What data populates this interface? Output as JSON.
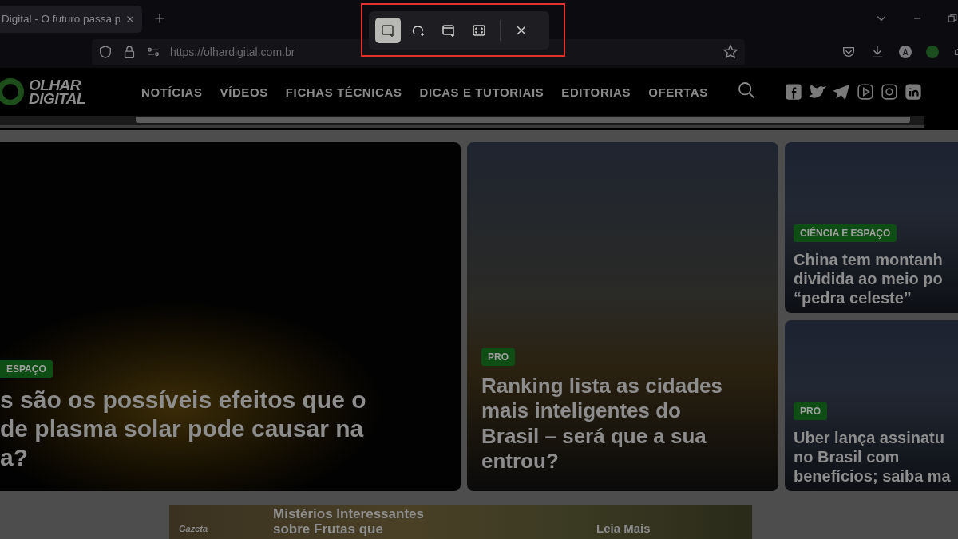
{
  "browser": {
    "tab_title": "Digital - O futuro passa p",
    "url": "https://olhardigital.com.br",
    "account_initial": "A"
  },
  "snip_toolbar": {
    "modes": [
      {
        "kind": "rectangle",
        "selected": true
      },
      {
        "kind": "freeform",
        "selected": false
      },
      {
        "kind": "window",
        "selected": false
      },
      {
        "kind": "fullscreen",
        "selected": false
      }
    ]
  },
  "site": {
    "logo_lines": [
      "OLHAR",
      "DIGITAL"
    ],
    "nav": [
      "NOTÍCIAS",
      "VÍDEOS",
      "FICHAS TÉCNICAS",
      "DICAS E TUTORIAIS",
      "EDITORIAS",
      "OFERTAS"
    ]
  },
  "cards": [
    {
      "kind": "large",
      "tag": "ESPAÇO",
      "headline_lines": [
        "s são os possíveis efeitos que o",
        "de plasma solar pode causar na",
        "a?"
      ]
    },
    {
      "kind": "medium",
      "tag": "PRO",
      "headline_lines": [
        "Ranking lista as cidades",
        "mais inteligentes do",
        "Brasil – será que a sua",
        "entrou?"
      ]
    },
    {
      "kind": "small",
      "tag": "CIÊNCIA E ESPAÇO",
      "headline_lines": [
        "China tem montanh",
        "dividida ao meio po",
        "“pedra celeste”"
      ]
    },
    {
      "kind": "small",
      "tag": "PRO",
      "headline_lines": [
        "Uber lança assinatu",
        "no Brasil com",
        "benefícios; saiba ma"
      ]
    }
  ],
  "ad": {
    "brand": "Gazeta",
    "title_lines": [
      "Mistérios Interessantes",
      "sobre Frutas que"
    ],
    "cta": "Leia Mais"
  }
}
